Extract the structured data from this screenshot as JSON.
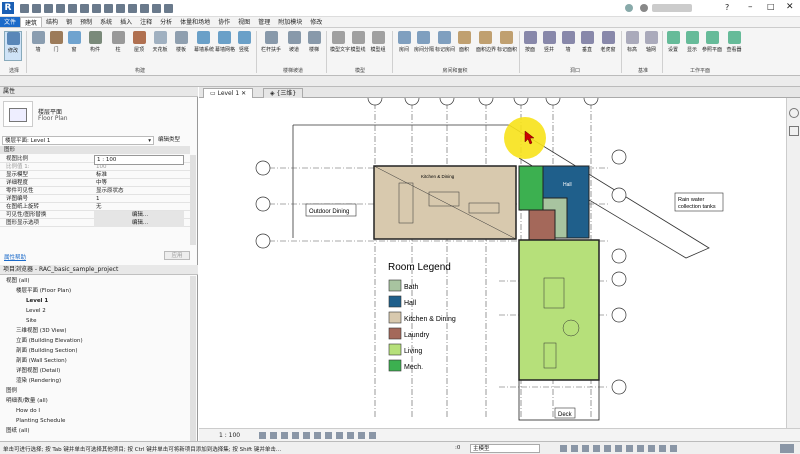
{
  "menu": [
    "文件",
    "建筑",
    "结构",
    "钢",
    "预制",
    "系统",
    "插入",
    "注释",
    "分析",
    "体量和场地",
    "协作",
    "视图",
    "管理",
    "附加模块",
    "修改"
  ],
  "ribbon": {
    "buttons": [
      "修改",
      "墙",
      "门",
      "窗",
      "构件",
      "柱",
      "屋顶",
      "天花板",
      "楼板",
      "幕墙系统",
      "幕墙网格",
      "竖梃",
      "栏杆扶手",
      "坡道",
      "楼梯",
      "模型文字",
      "模型线",
      "模型组",
      "房间",
      "房间分隔",
      "标记房间",
      "面积",
      "面积边界",
      "标记面积",
      "按面",
      "竖井",
      "墙",
      "垂直",
      "老虎窗",
      "标高",
      "轴网",
      "设置",
      "显示",
      "参照平面",
      "查看器"
    ],
    "groups": [
      "选择",
      "构建",
      "楼梯坡道",
      "模型",
      "房间和面积",
      "洞口",
      "基准",
      "工作平面"
    ]
  },
  "props": {
    "header": "属性",
    "type_name": "楼层平面",
    "type_sub": "Floor Plan",
    "selector": "楼层平面: Level 1",
    "edit_type": "编辑类型",
    "section": "图形",
    "rows": [
      {
        "k": "视图比例",
        "v": "1 : 100"
      },
      {
        "k": "比例值 1:",
        "v": "100"
      },
      {
        "k": "显示模型",
        "v": "标准"
      },
      {
        "k": "详细程度",
        "v": "中等"
      },
      {
        "k": "零件可见性",
        "v": "显示原状态"
      },
      {
        "k": "详图编号",
        "v": "1"
      },
      {
        "k": "在图纸上旋转",
        "v": "无"
      },
      {
        "k": "可见性/图形替换",
        "v": "编辑..."
      },
      {
        "k": "图形显示选项",
        "v": "编辑..."
      }
    ],
    "help": "属性帮助",
    "apply": "应用"
  },
  "browser": {
    "header": "项目浏览器 - RAC_basic_sample_project",
    "items": [
      {
        "t": "视图 (all)",
        "d": 0
      },
      {
        "t": "楼层平面 (Floor Plan)",
        "d": 1
      },
      {
        "t": "Level 1",
        "d": 2,
        "bold": true
      },
      {
        "t": "Level 2",
        "d": 2
      },
      {
        "t": "Site",
        "d": 2
      },
      {
        "t": "三维视图 (3D View)",
        "d": 1
      },
      {
        "t": "立面 (Building Elevation)",
        "d": 1
      },
      {
        "t": "剖面 (Building Section)",
        "d": 1
      },
      {
        "t": "剖面 (Wall Section)",
        "d": 1
      },
      {
        "t": "详图视图 (Detail)",
        "d": 1
      },
      {
        "t": "渲染 (Rendering)",
        "d": 1
      },
      {
        "t": "图例",
        "d": 0
      },
      {
        "t": "明细表/数量 (all)",
        "d": 0
      },
      {
        "t": "How do I",
        "d": 1
      },
      {
        "t": "Planting Schedule",
        "d": 1
      },
      {
        "t": "图纸 (all)",
        "d": 0
      }
    ]
  },
  "tabs": {
    "active": "Level 1",
    "second": "{三维}"
  },
  "plan": {
    "legend_title": "Room Legend",
    "legend": [
      {
        "name": "Bath",
        "color": "#a8c4a0"
      },
      {
        "name": "Hall",
        "color": "#1f5f8b"
      },
      {
        "name": "Kitchen & Dining",
        "color": "#d8c9ae"
      },
      {
        "name": "Laundry",
        "color": "#a4685a"
      },
      {
        "name": "Living",
        "color": "#b6e07a"
      },
      {
        "name": "Mech.",
        "color": "#3cb050"
      }
    ],
    "labels": {
      "outdoor": "Outdoor Dining",
      "kitchen": "Kitchen & Dining",
      "hall": "Hall",
      "deck": "Deck",
      "rain1": "Rain water",
      "rain2": "collection tanks"
    },
    "grid_letters": [
      "A",
      "B",
      "C",
      "A",
      "B",
      "C",
      "D",
      "E",
      "F"
    ],
    "grid_numbers": [
      "1",
      "2",
      "3",
      "4",
      "5",
      "6",
      "7"
    ]
  },
  "viewctl": {
    "scale": "1 : 100"
  },
  "status": {
    "text": "单击可进行选择; 按 Tab 键并单击可选择其他项目; 按 Ctrl 键并单击可将新项目添加到选择集; 按 Shift 键并单击...",
    "model": "主模型",
    "zero": ":0"
  },
  "colors": {
    "accent": "#1b6ac9",
    "cursor": "#f7e21a"
  }
}
